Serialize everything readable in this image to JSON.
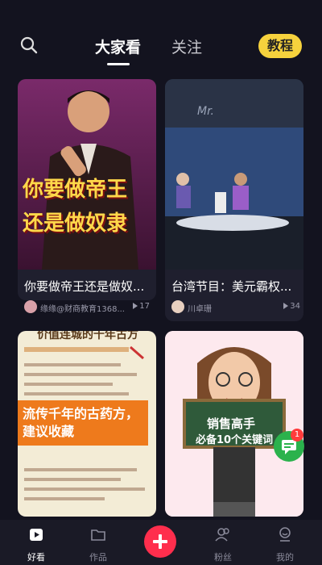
{
  "header": {
    "tabs": [
      {
        "label": "大家看",
        "active": true
      },
      {
        "label": "关注",
        "active": false
      }
    ],
    "tutorial_button": "教程",
    "icons": {
      "search": "search-icon"
    }
  },
  "feed": [
    {
      "title": "你要做帝王还是做奴...",
      "author": "缘缘@财商教育1368...",
      "views": "17",
      "overlay_text_1": "你要做帝王",
      "overlay_text_2": "还是做奴隶"
    },
    {
      "title": "台湾节目：美元霸权...",
      "author": "川卓珊",
      "views": "34"
    },
    {
      "heading": "价值连城的千年古方",
      "overlay_text": "流传千年的古药方，建议收藏"
    },
    {
      "board_line_1": "销售高手",
      "board_line_2": "必备10个关键词",
      "notification_count": "1"
    }
  ],
  "bottom_nav": [
    {
      "label": "好看",
      "icon": "video-home-icon",
      "active": true
    },
    {
      "label": "作品",
      "icon": "folder-icon",
      "active": false
    },
    {
      "label": "",
      "icon": "plus-icon",
      "active": false
    },
    {
      "label": "粉丝",
      "icon": "fans-icon",
      "active": false
    },
    {
      "label": "我的",
      "icon": "profile-icon",
      "active": false
    }
  ],
  "colors": {
    "accent_yellow": "#f6d23d",
    "accent_red": "#ff2e4d",
    "background": "#13131f"
  }
}
